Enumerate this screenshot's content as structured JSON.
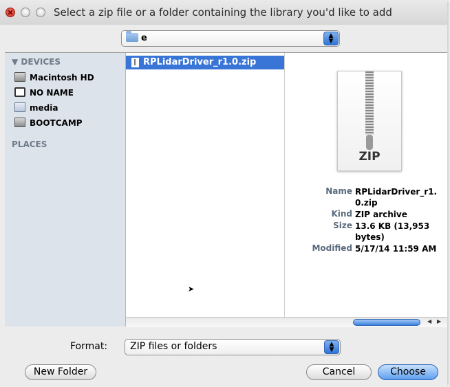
{
  "window": {
    "title": "Select a zip file or a folder containing the library you'd like to add"
  },
  "path_popup": {
    "value": "e",
    "icon": "folder-icon"
  },
  "sidebar": {
    "devices_header": "▼ DEVICES",
    "places_header": "PLACES",
    "items": [
      {
        "label": "Macintosh HD",
        "icon": "hard-drive-icon"
      },
      {
        "label": "NO NAME",
        "icon": "sd-card-icon"
      },
      {
        "label": "media",
        "icon": "media-drive-icon"
      },
      {
        "label": "BOOTCAMP",
        "icon": "hard-drive-icon"
      }
    ]
  },
  "file_list": {
    "selected_file": "RPLidarDriver_r1.0.zip"
  },
  "preview": {
    "badge": "ZIP",
    "name_label": "Name",
    "name_value": "RPLidarDriver_r1.0.zip",
    "kind_label": "Kind",
    "kind_value": "ZIP archive",
    "size_label": "Size",
    "size_value": "13.6 KB (13,953 bytes)",
    "modified_label": "Modified",
    "modified_value": "5/17/14 11:59 AM"
  },
  "format": {
    "label": "Format:",
    "value": "ZIP files or folders"
  },
  "buttons": {
    "new_folder": "New Folder",
    "cancel": "Cancel",
    "choose": "Choose"
  }
}
